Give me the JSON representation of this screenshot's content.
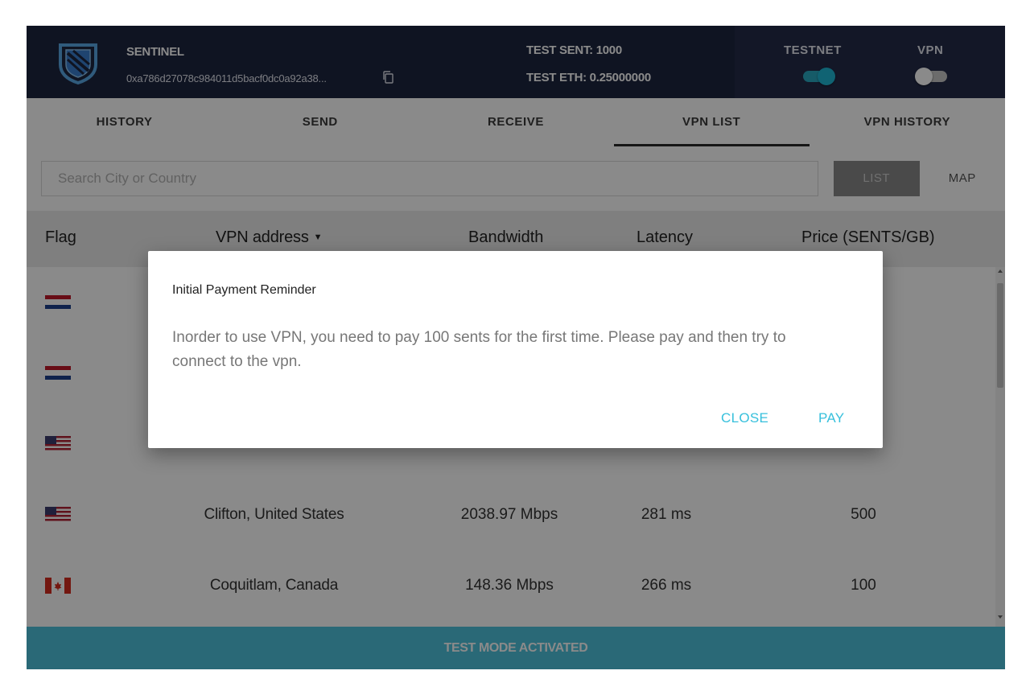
{
  "header": {
    "brand": "SENTINEL",
    "address": "0xa786d27078c984011d5bacf0dc0a92a38...",
    "test_sent": "TEST SENT: 1000",
    "test_eth": "TEST ETH: 0.25000000",
    "testnet_label": "TESTNET",
    "vpn_label": "VPN",
    "testnet_on": true,
    "vpn_on": false
  },
  "tabs": [
    {
      "label": "HISTORY"
    },
    {
      "label": "SEND"
    },
    {
      "label": "RECEIVE"
    },
    {
      "label": "VPN LIST",
      "active": true
    },
    {
      "label": "VPN HISTORY"
    }
  ],
  "search": {
    "placeholder": "Search City or Country",
    "value": ""
  },
  "view_toggle": {
    "list": "LIST",
    "map": "MAP",
    "selected": "LIST"
  },
  "table": {
    "headers": {
      "flag": "Flag",
      "address": "VPN address",
      "bandwidth": "Bandwidth",
      "latency": "Latency",
      "price": "Price (SENTS/GB)"
    },
    "rows": [
      {
        "flag": "netherlands",
        "address": "",
        "bandwidth": "",
        "latency": "",
        "price": ""
      },
      {
        "flag": "netherlands",
        "address": "",
        "bandwidth": "",
        "latency": "",
        "price": ""
      },
      {
        "flag": "united-states",
        "address": "",
        "bandwidth": "",
        "latency": "",
        "price": ""
      },
      {
        "flag": "united-states",
        "address": "Clifton, United States",
        "bandwidth": "2038.97 Mbps",
        "latency": "281 ms",
        "price": "500"
      },
      {
        "flag": "canada",
        "address": "Coquitlam, Canada",
        "bandwidth": "148.36 Mbps",
        "latency": "266 ms",
        "price": "100"
      }
    ]
  },
  "footer": {
    "text": "TEST MODE ACTIVATED"
  },
  "dialog": {
    "title": "Initial Payment Reminder",
    "body": "Inorder to use VPN, you need to pay 100 sents for the first time. Please pay and then try to connect to the vpn.",
    "close_label": "CLOSE",
    "pay_label": "PAY"
  },
  "colors": {
    "header_bg": "#1c2540",
    "accent": "#37c0dc",
    "footer_bg": "#4ec3dc"
  }
}
